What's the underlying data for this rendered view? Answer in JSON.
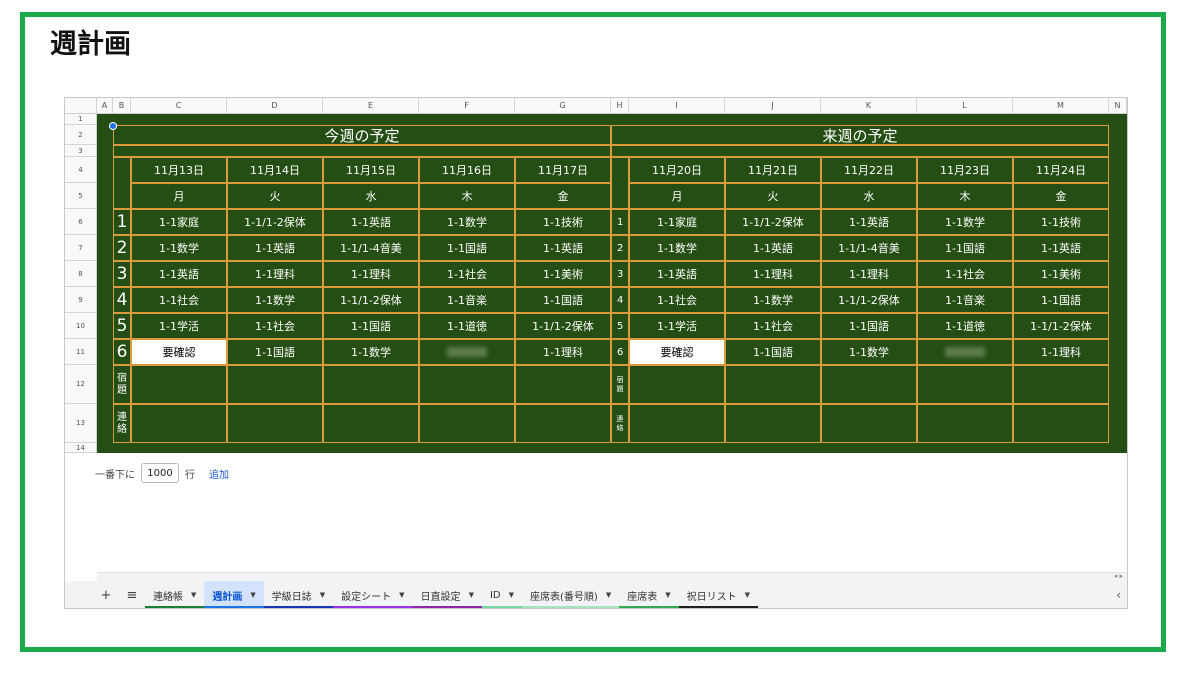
{
  "page": {
    "title": "週計画"
  },
  "sheet": {
    "columns": [
      "A",
      "B",
      "C",
      "D",
      "E",
      "F",
      "G",
      "H",
      "I",
      "J",
      "K",
      "L",
      "M",
      "N"
    ],
    "rows": [
      "1",
      "2",
      "3",
      "4",
      "5",
      "6",
      "7",
      "8",
      "9",
      "10",
      "11",
      "12",
      "13",
      "14"
    ],
    "this_week": {
      "title": "今週の予定",
      "dates": [
        "11月13日",
        "11月14日",
        "11月15日",
        "11月16日",
        "11月17日"
      ],
      "days": [
        "月",
        "火",
        "水",
        "木",
        "金"
      ],
      "periods": [
        {
          "num": "1",
          "subjects": [
            "1-1家庭",
            "1-1/1-2保体",
            "1-1英語",
            "1-1数学",
            "1-1技術"
          ]
        },
        {
          "num": "2",
          "subjects": [
            "1-1数学",
            "1-1英語",
            "1-1/1-4音美",
            "1-1国語",
            "1-1英語"
          ]
        },
        {
          "num": "3",
          "subjects": [
            "1-1英語",
            "1-1理科",
            "1-1理科",
            "1-1社会",
            "1-1美術"
          ]
        },
        {
          "num": "4",
          "subjects": [
            "1-1社会",
            "1-1数学",
            "1-1/1-2保体",
            "1-1音楽",
            "1-1国語"
          ]
        },
        {
          "num": "5",
          "subjects": [
            "1-1学活",
            "1-1社会",
            "1-1国語",
            "1-1道徳",
            "1-1/1-2保体"
          ]
        },
        {
          "num": "6",
          "subjects": [
            "要確認",
            "1-1国語",
            "1-1数学",
            "",
            "1-1理科"
          ]
        }
      ],
      "homework_label": "宿題",
      "contact_label": "連絡"
    },
    "next_week": {
      "title": "来週の予定",
      "dates": [
        "11月20日",
        "11月21日",
        "11月22日",
        "11月23日",
        "11月24日"
      ],
      "days": [
        "月",
        "火",
        "水",
        "木",
        "金"
      ],
      "periods": [
        {
          "num": "1",
          "subjects": [
            "1-1家庭",
            "1-1/1-2保体",
            "1-1英語",
            "1-1数学",
            "1-1技術"
          ]
        },
        {
          "num": "2",
          "subjects": [
            "1-1数学",
            "1-1英語",
            "1-1/1-4音美",
            "1-1国語",
            "1-1英語"
          ]
        },
        {
          "num": "3",
          "subjects": [
            "1-1英語",
            "1-1理科",
            "1-1理科",
            "1-1社会",
            "1-1美術"
          ]
        },
        {
          "num": "4",
          "subjects": [
            "1-1社会",
            "1-1数学",
            "1-1/1-2保体",
            "1-1音楽",
            "1-1国語"
          ]
        },
        {
          "num": "5",
          "subjects": [
            "1-1学活",
            "1-1社会",
            "1-1国語",
            "1-1道徳",
            "1-1/1-2保体"
          ]
        },
        {
          "num": "6",
          "subjects": [
            "要確認",
            "1-1国語",
            "1-1数学",
            "",
            "1-1理科"
          ]
        }
      ],
      "homework_label": "宿題",
      "contact_label": "連絡"
    },
    "add_rows": {
      "prefix": "一番下に",
      "count": "1000",
      "unit": "行",
      "link": "追加"
    }
  },
  "tabs": {
    "add_icon": "+",
    "menu_icon": "≡",
    "items": [
      {
        "label": "連絡帳",
        "color": "#188038",
        "active": false
      },
      {
        "label": "週計画",
        "color": "#1a73e8",
        "active": true
      },
      {
        "label": "学級日誌",
        "color": "#1a33b8",
        "active": false
      },
      {
        "label": "設定シート",
        "color": "#9334e6",
        "active": false
      },
      {
        "label": "日直設定",
        "color": "#8e24aa",
        "active": false
      },
      {
        "label": "ID",
        "color": "#76d7a4",
        "active": false
      },
      {
        "label": "座席表(番号順)",
        "color": "#a6e3bf",
        "active": false
      },
      {
        "label": "座席表",
        "color": "#34a853",
        "active": false
      },
      {
        "label": "祝日リスト",
        "color": "#202124",
        "active": false
      }
    ]
  }
}
